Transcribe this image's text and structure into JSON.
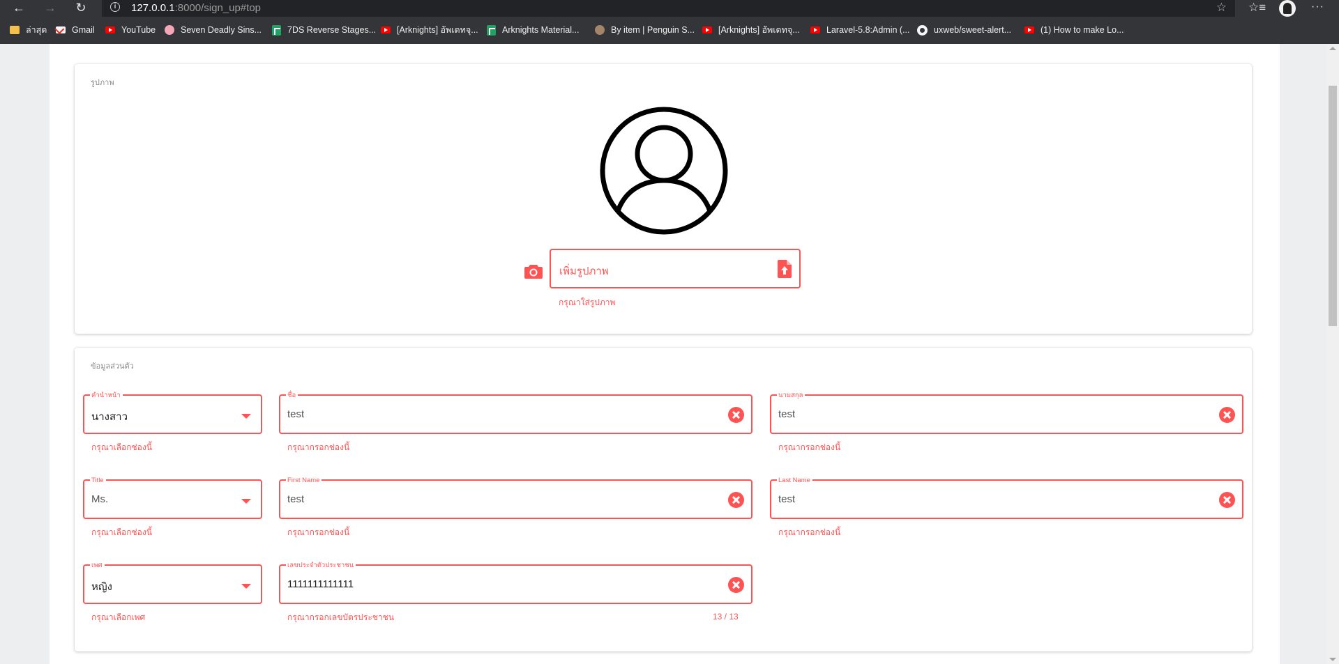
{
  "browser": {
    "url_host": "127.0.0.1",
    "url_path": ":8000/sign_up#top",
    "bookmarks": [
      {
        "label": "ล่าสุด",
        "icon": "folder-icon"
      },
      {
        "label": "Gmail",
        "icon": "gmail-icon"
      },
      {
        "label": "YouTube",
        "icon": "youtube-icon"
      },
      {
        "label": "Seven Deadly Sins...",
        "icon": "brain-icon"
      },
      {
        "label": "7DS Reverse Stages...",
        "icon": "sheets-icon"
      },
      {
        "label": "[Arknights] อัพเดทจุ...",
        "icon": "youtube-icon"
      },
      {
        "label": "Arknights Material...",
        "icon": "sheets-icon"
      },
      {
        "label": "By item | Penguin S...",
        "icon": "penguin-icon"
      },
      {
        "label": "[Arknights] อัพเดทจุ...",
        "icon": "youtube-icon"
      },
      {
        "label": "Laravel-5.8:Admin (...",
        "icon": "youtube-icon"
      },
      {
        "label": "uxweb/sweet-alert...",
        "icon": "github-icon"
      },
      {
        "label": "(1) How to make Lo...",
        "icon": "youtube-icon"
      }
    ]
  },
  "photo_section": {
    "title": "รูปภาพ",
    "upload_placeholder": "เพิ่มรูปภาพ",
    "upload_error": "กรุณาใส่รูปภาพ"
  },
  "personal_section": {
    "title": "ข้อมูลส่วนตัว",
    "prefix_th": {
      "label": "คำนำหน้า",
      "value": "นางสาว",
      "error": "กรุณาเลือกช่องนี้"
    },
    "first_name_th": {
      "label": "ชื่อ",
      "value": "test",
      "error": "กรุณากรอกช่องนี้"
    },
    "last_name_th": {
      "label": "นามสกุล",
      "value": "test",
      "error": "กรุณากรอกช่องนี้"
    },
    "title_en": {
      "label": "Title",
      "value": "Ms.",
      "error": "กรุณาเลือกช่องนี้"
    },
    "first_name_en": {
      "label": "First Name",
      "value": "test",
      "error": "กรุณากรอกช่องนี้"
    },
    "last_name_en": {
      "label": "Last Name",
      "value": "test",
      "error": "กรุณากรอกช่องนี้"
    },
    "gender": {
      "label": "เพศ",
      "value": "หญิง",
      "error": "กรุณาเลือกเพศ"
    },
    "national_id": {
      "label": "เลขประจำตัวประชาชน",
      "value": "1111111111111",
      "error": "กรุณากรอกเลขบัตรประชาชน",
      "counter": "13 / 13"
    }
  },
  "colors": {
    "error": "#ff5252",
    "chrome": "#333538"
  }
}
